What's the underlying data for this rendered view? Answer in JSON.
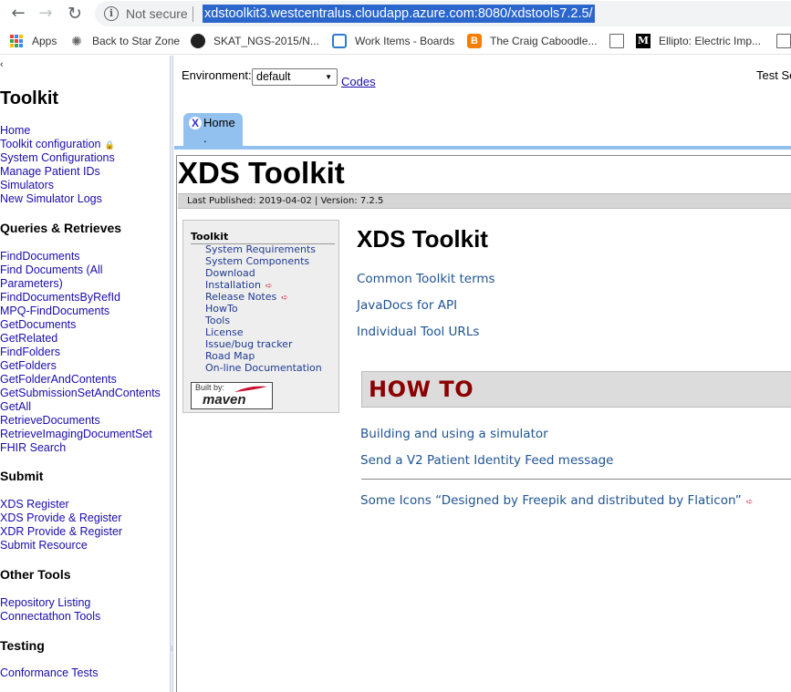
{
  "browser": {
    "security_label": "Not secure",
    "url": "xdstoolkit3.westcentralus.cloudapp.azure.com:8080/xdstools7.2.5/",
    "bookmarks": [
      {
        "label": "Apps",
        "icon": "apps-grid-icon"
      },
      {
        "label": "Back to Star Zone",
        "icon": "star-zone-icon"
      },
      {
        "label": "SKAT_NGS-2015/N...",
        "icon": "github-icon"
      },
      {
        "label": "Work Items - Boards",
        "icon": "azure-devops-icon"
      },
      {
        "label": "The Craig Caboodle...",
        "icon": "blogger-icon"
      },
      {
        "label": "",
        "icon": "page-icon"
      },
      {
        "label": "Ellipto: Electric Imp...",
        "icon": "medium-icon"
      },
      {
        "label": "",
        "icon": "page-icon"
      }
    ]
  },
  "nav": {
    "collapse": "‹",
    "title": "Toolkit",
    "top_links": [
      "Home",
      "Toolkit configuration",
      "System Configurations",
      "Manage Patient IDs",
      "Simulators",
      "New Simulator Logs"
    ],
    "sections": [
      {
        "title": "Queries & Retrieves",
        "links": [
          "FindDocuments",
          "Find Documents (All",
          "Parameters)",
          "FindDocumentsByRefId",
          "MPQ-FindDocuments",
          "GetDocuments",
          "GetRelated",
          "FindFolders",
          "GetFolders",
          "GetFolderAndContents",
          "GetSubmissionSetAndContents",
          "GetAll",
          "RetrieveDocuments",
          "RetrieveImagingDocumentSet",
          "FHIR Search"
        ]
      },
      {
        "title": "Submit",
        "links": [
          "XDS Register",
          "XDS Provide & Register",
          "XDR Provide & Register",
          "Submit Resource"
        ]
      },
      {
        "title": "Other Tools",
        "links": [
          "Repository Listing",
          "Connectathon Tools"
        ]
      },
      {
        "title": "Testing",
        "links": [
          "Conformance Tests"
        ]
      }
    ]
  },
  "content": {
    "environment_label": "Environment:",
    "environment_value": "default",
    "codes_label": "Codes",
    "test_session_label": "Test Se",
    "tab_label": "Home",
    "tab_close": "X",
    "tab_sub": "."
  },
  "doc": {
    "title": "XDS Toolkit",
    "published": "Last Published: 2019-04-02  | Version: 7.2.5",
    "toolbox_title": "Toolkit",
    "toolbox_links": [
      "System Requirements",
      "System Components",
      "Download",
      "Installation",
      "Release Notes",
      "HowTo",
      "Tools",
      "License",
      "Issue/bug tracker",
      "Road Map",
      "On-line Documentation"
    ],
    "maven_by": "Built by:",
    "maven_word": "maven",
    "main_heading": "XDS Toolkit",
    "main_links": [
      "Common Toolkit terms",
      "JavaDocs for API",
      "Individual Tool URLs"
    ],
    "howto_heading": "HOW TO",
    "howto_links": [
      "Building and using a simulator",
      "Send a V2 Patient Identity Feed message"
    ],
    "credits": "Some Icons “Designed by Freepik and distributed by Flaticon”"
  }
}
